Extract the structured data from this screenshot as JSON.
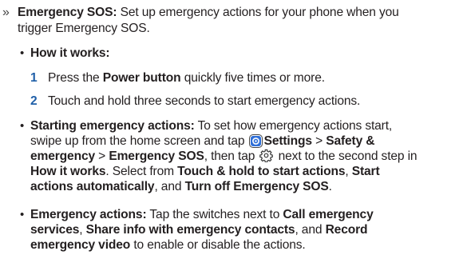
{
  "intro": {
    "marker": "»",
    "title": "Emergency SOS:",
    "text_1": "Set up emergency actions for your phone when you",
    "text_2": "trigger Emergency SOS."
  },
  "how_it_works": {
    "bullet": "•",
    "title": "How it works:",
    "steps": [
      {
        "num": "1",
        "pre": "Press the ",
        "bold": "Power button",
        "post": " quickly five times or more."
      },
      {
        "num": "2",
        "text": "Touch and hold three seconds to start emergency actions."
      }
    ]
  },
  "starting": {
    "bullet": "•",
    "title": "Starting emergency actions:",
    "l1_rest": "To set how emergency actions start,",
    "l2_pre": "swipe up from the home screen and tap",
    "l2_settings": "Settings",
    "l2_sep": " > ",
    "l2_safety": "Safety &",
    "l3_emergency": "emergency",
    "l3_sep": " > ",
    "l3_sos": "Emergency SOS",
    "l3_mid": ", then tap",
    "l3_post": "next to the second step in",
    "l4_how": "How it works",
    "l4_mid": ". Select from ",
    "l4_touch": "Touch & hold to start actions",
    "l4_comma": ", ",
    "l4_start": "Start",
    "l5_auto": "actions automatically",
    "l5_and": ", and ",
    "l5_turn": "Turn off Emergency SOS",
    "l5_end": "."
  },
  "actions": {
    "bullet": "•",
    "title": "Emergency actions:",
    "l1_rest": "Tap the switches next to ",
    "l1_call": "Call emergency",
    "l2_services": "services",
    "l2_comma": ", ",
    "l2_share": "Share info with emergency contacts",
    "l2_and": ", and ",
    "l2_record": "Record",
    "l3_video": "emergency video",
    "l3_rest": " to enable or disable the actions."
  },
  "icons": {
    "settings": "settings-app-icon",
    "gear": "gear-icon",
    "settings_color": "#2f6fd8"
  }
}
